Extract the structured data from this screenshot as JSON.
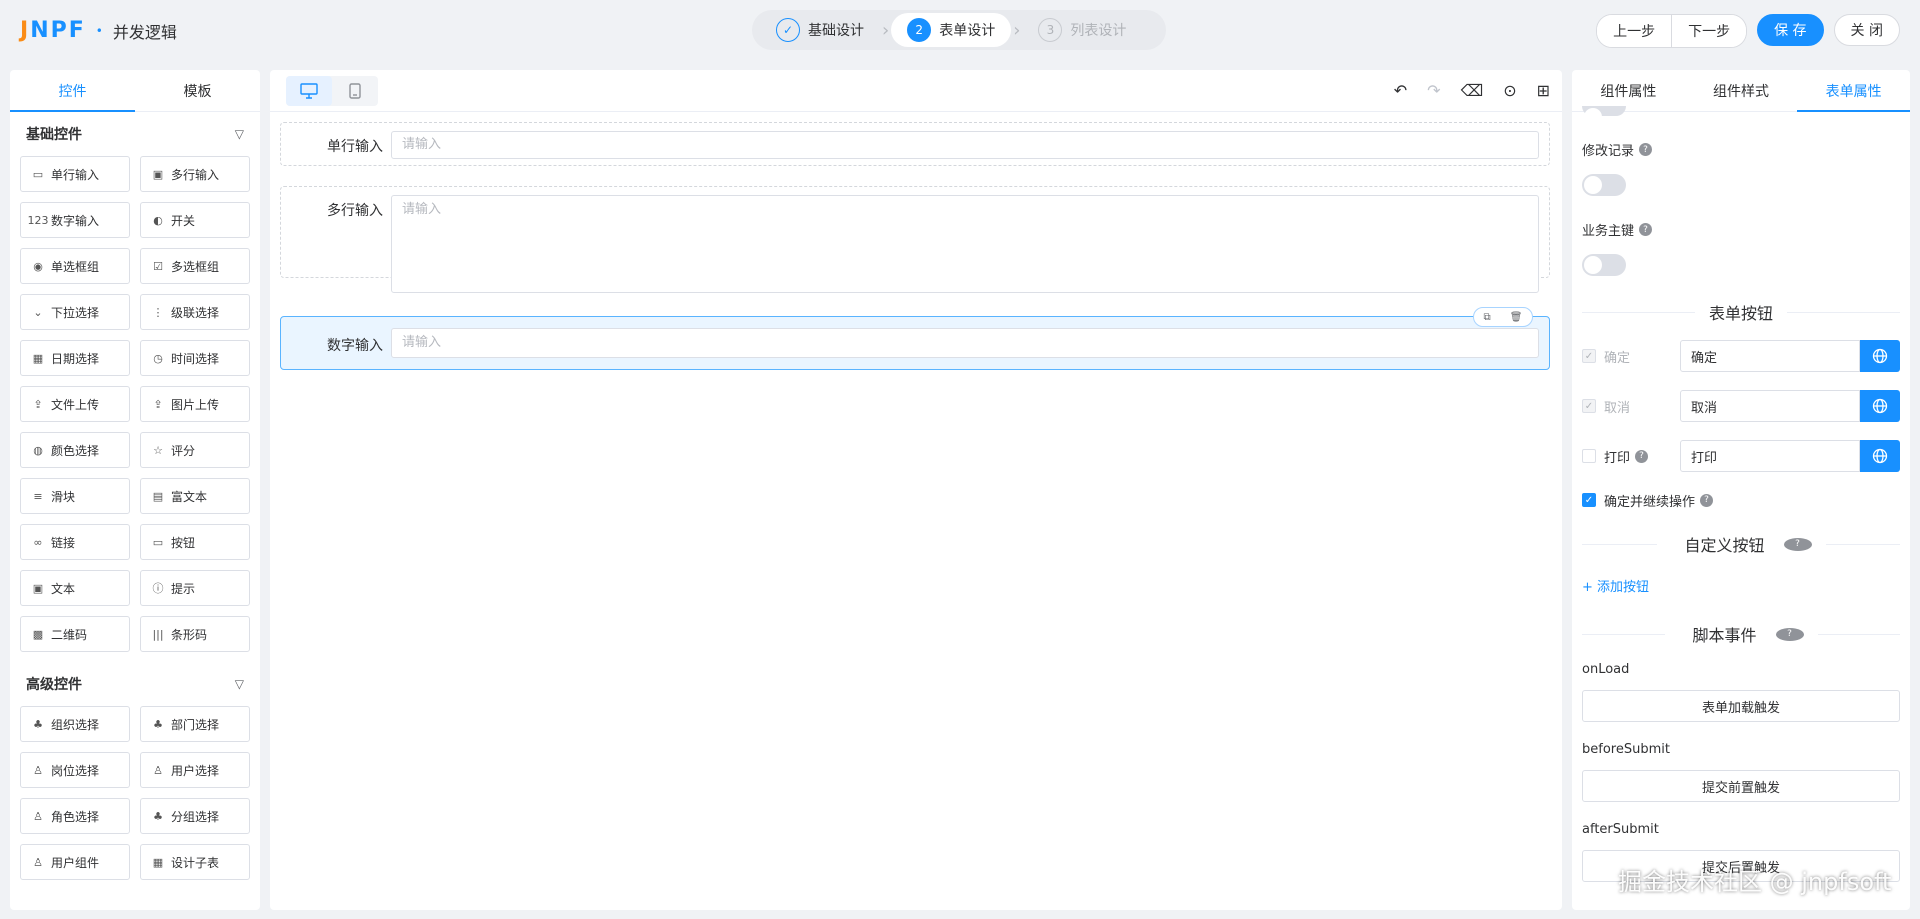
{
  "header": {
    "logo": "JNPF",
    "title": "并发逻辑",
    "steps": [
      {
        "num": "✓",
        "label": "基础设计"
      },
      {
        "num": "2",
        "label": "表单设计"
      },
      {
        "num": "3",
        "label": "列表设计"
      }
    ],
    "prev": "上一步",
    "next": "下一步",
    "save": "保 存",
    "close": "关 闭"
  },
  "left": {
    "tabs": [
      "控件",
      "模板"
    ],
    "basic_title": "基础控件",
    "basic": [
      {
        "icon": "▭",
        "label": "单行输入"
      },
      {
        "icon": "▣",
        "label": "多行输入"
      },
      {
        "icon": "123",
        "label": "数字输入"
      },
      {
        "icon": "◐",
        "label": "开关"
      },
      {
        "icon": "◉",
        "label": "单选框组"
      },
      {
        "icon": "☑",
        "label": "多选框组"
      },
      {
        "icon": "⌄",
        "label": "下拉选择"
      },
      {
        "icon": "⋮",
        "label": "级联选择"
      },
      {
        "icon": "▦",
        "label": "日期选择"
      },
      {
        "icon": "◷",
        "label": "时间选择"
      },
      {
        "icon": "⇪",
        "label": "文件上传"
      },
      {
        "icon": "⇪",
        "label": "图片上传"
      },
      {
        "icon": "◍",
        "label": "颜色选择"
      },
      {
        "icon": "☆",
        "label": "评分"
      },
      {
        "icon": "≡",
        "label": "滑块"
      },
      {
        "icon": "▤",
        "label": "富文本"
      },
      {
        "icon": "∞",
        "label": "链接"
      },
      {
        "icon": "▭",
        "label": "按钮"
      },
      {
        "icon": "▣",
        "label": "文本"
      },
      {
        "icon": "ⓘ",
        "label": "提示"
      },
      {
        "icon": "▩",
        "label": "二维码"
      },
      {
        "icon": "|||",
        "label": "条形码"
      }
    ],
    "advanced_title": "高级控件",
    "advanced": [
      {
        "icon": "♣",
        "label": "组织选择"
      },
      {
        "icon": "♣",
        "label": "部门选择"
      },
      {
        "icon": "♙",
        "label": "岗位选择"
      },
      {
        "icon": "♙",
        "label": "用户选择"
      },
      {
        "icon": "♙",
        "label": "角色选择"
      },
      {
        "icon": "♣",
        "label": "分组选择"
      },
      {
        "icon": "♙",
        "label": "用户组件"
      },
      {
        "icon": "▦",
        "label": "设计子表"
      }
    ]
  },
  "center": {
    "fields": [
      {
        "label": "单行输入",
        "placeholder": "请输入"
      },
      {
        "label": "多行输入",
        "placeholder": "请输入"
      },
      {
        "label": "数字输入",
        "placeholder": "请输入"
      }
    ]
  },
  "right": {
    "tabs": [
      "组件属性",
      "组件样式",
      "表单属性"
    ],
    "modify_record": "修改记录",
    "business_key": "业务主键",
    "form_buttons_title": "表单按钮",
    "buttons": [
      {
        "label": "确定",
        "value": "确定"
      },
      {
        "label": "取消",
        "value": "取消"
      },
      {
        "label": "打印",
        "value": "打印"
      }
    ],
    "confirm_continue": "确定并继续操作",
    "custom_buttons_title": "自定义按钮",
    "add_button": "+ 添加按钮",
    "script_title": "脚本事件",
    "events": [
      {
        "name": "onLoad",
        "button": "表单加载触发"
      },
      {
        "name": "beforeSubmit",
        "button": "提交前置触发"
      },
      {
        "name": "afterSubmit",
        "button": "提交后置触发"
      }
    ]
  },
  "watermark": "掘金技术社区 @ jnpfsoft"
}
